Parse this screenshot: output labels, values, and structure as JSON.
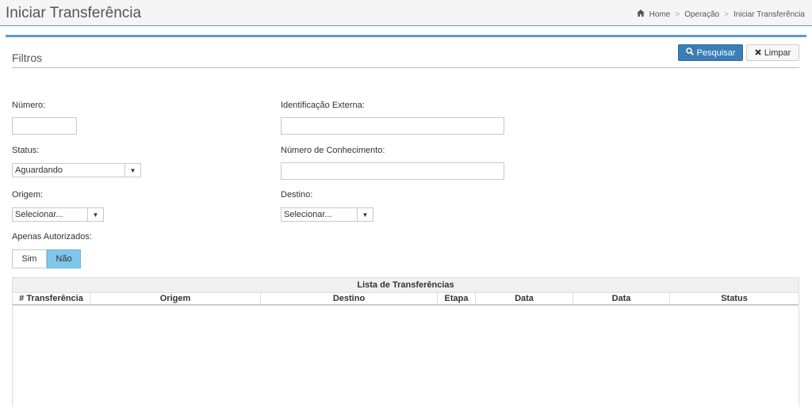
{
  "header": {
    "title": "Iniciar Transferência",
    "breadcrumb": {
      "home": "Home",
      "sep": ">",
      "level1": "Operação",
      "current": "Iniciar Transferência"
    }
  },
  "filters": {
    "title": "Filtros",
    "search_button": "Pesquisar",
    "clear_button": "Limpar",
    "numero": {
      "label": "Número:",
      "value": ""
    },
    "identificacao_externa": {
      "label": "Identificação Externa:",
      "value": ""
    },
    "status": {
      "label": "Status:",
      "selected": "Aguardando"
    },
    "numero_conhecimento": {
      "label": "Número de Conhecimento:",
      "value": ""
    },
    "origem": {
      "label": "Origem:",
      "selected": "Selecionar..."
    },
    "destino": {
      "label": "Destino:",
      "selected": "Selecionar..."
    },
    "apenas_autorizados": {
      "label": "Apenas Autorizados:",
      "options": [
        "Sim",
        "Não"
      ],
      "selected": "Não"
    }
  },
  "table": {
    "caption": "Lista de Transferências",
    "columns": [
      "# Transferência",
      "Origem",
      "Destino",
      "Etapa",
      "Data",
      "Data",
      "Status"
    ],
    "rows": []
  },
  "colors": {
    "accent": "#5b9bd5",
    "primary_button": "#3b7db5",
    "toggle_active": "#7ec6ea"
  },
  "icons": {
    "home": "home-icon",
    "search": "search-icon",
    "clear": "close-icon",
    "caret": "caret-down-icon"
  }
}
